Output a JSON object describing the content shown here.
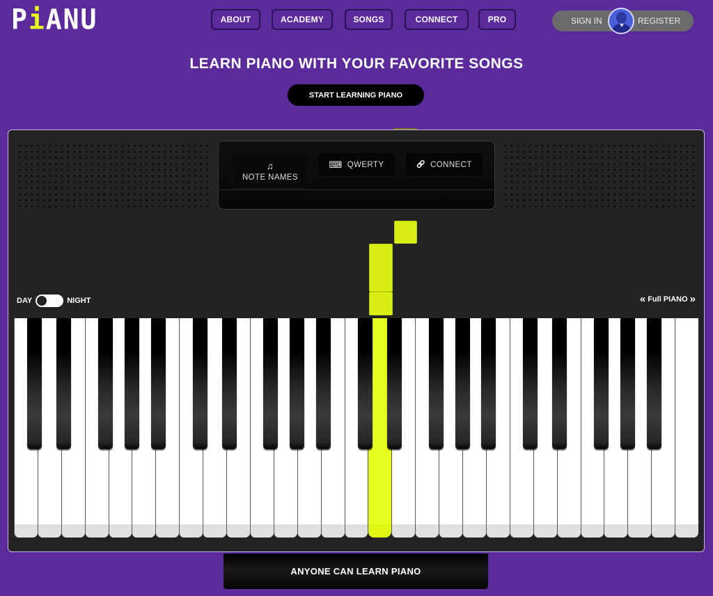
{
  "brand": {
    "logo_text_pre": "P",
    "logo_dot": "i",
    "logo_text_post": "ANU"
  },
  "nav": {
    "items": [
      {
        "label": "ABOUT"
      },
      {
        "label": "ACADEMY"
      },
      {
        "label": "SONGS"
      },
      {
        "label": "CONNECT"
      },
      {
        "label": "PRO"
      }
    ],
    "sign_in": "SIGN IN",
    "register": "REGISTER",
    "avatar_icon": "user-avatar-icon"
  },
  "hero": {
    "title": "LEARN PIANO WITH YOUR FAVORITE SONGS",
    "cta_label": "START LEARNING PIANO"
  },
  "piano": {
    "modes": [
      {
        "label": "NOTE NAMES",
        "icon": "music-note-icon",
        "glyph": "♫",
        "active": true
      },
      {
        "label": "QWERTY",
        "icon": "keyboard-icon",
        "glyph": "⌨",
        "active": false
      },
      {
        "label": "CONNECT",
        "icon": "link-icon",
        "glyph": "🔗",
        "active": false
      }
    ],
    "theme_toggle": {
      "left_label": "DAY",
      "right_label": "NIGHT",
      "state": "day"
    },
    "range": {
      "label": "Full PIANO",
      "prev_icon": "«",
      "next_icon": "»"
    },
    "white_key_count": 29,
    "first_note": "C",
    "highlighted_key": {
      "note": "D",
      "white_index": 15
    },
    "highlight_color": "#e6ff1e"
  },
  "colors": {
    "background": "#5b2a9b",
    "piano_body": "#232323",
    "accent": "#e6ff1e"
  },
  "footer_banner": "ANYONE CAN LEARN PIANO"
}
